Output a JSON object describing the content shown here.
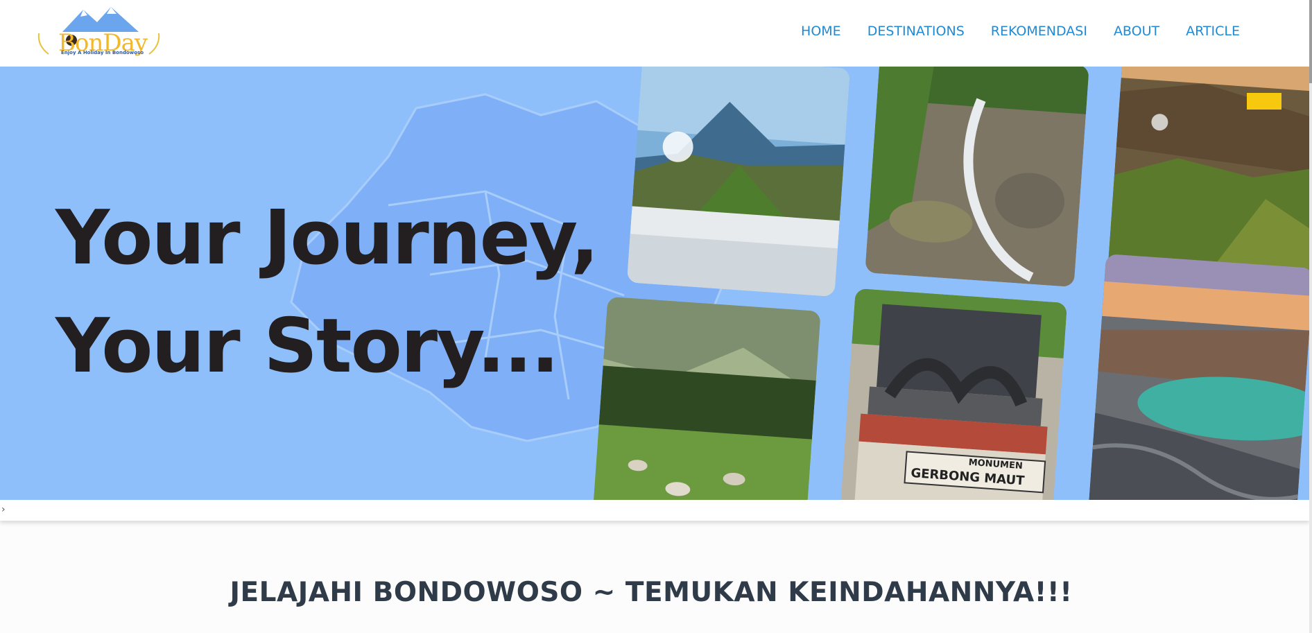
{
  "brand": {
    "name": "BonDay",
    "tagline": "Enjoy A Holiday In Bondowoso"
  },
  "nav": {
    "items": [
      "HOME",
      "DESTINATIONS",
      "REKOMENDASI",
      "ABOUT",
      "ARTICLE"
    ]
  },
  "hero": {
    "line1": "Your Journey,",
    "line2": "Your Story...",
    "background_color": "#8fbffb",
    "monument_sign_line1": "MONUMEN",
    "monument_sign_line2": "GERBONG MAUT"
  },
  "slider": {
    "next_arrow": "›"
  },
  "section": {
    "heading": "JELAJAHI BONDOWOSO ~ TEMUKAN KEINDAHANNYA!!!"
  },
  "colors": {
    "nav_link": "#1e8ad6",
    "hero_text": "#231f20",
    "accent_badge": "#f6c90e",
    "heading": "#2f3b48"
  }
}
